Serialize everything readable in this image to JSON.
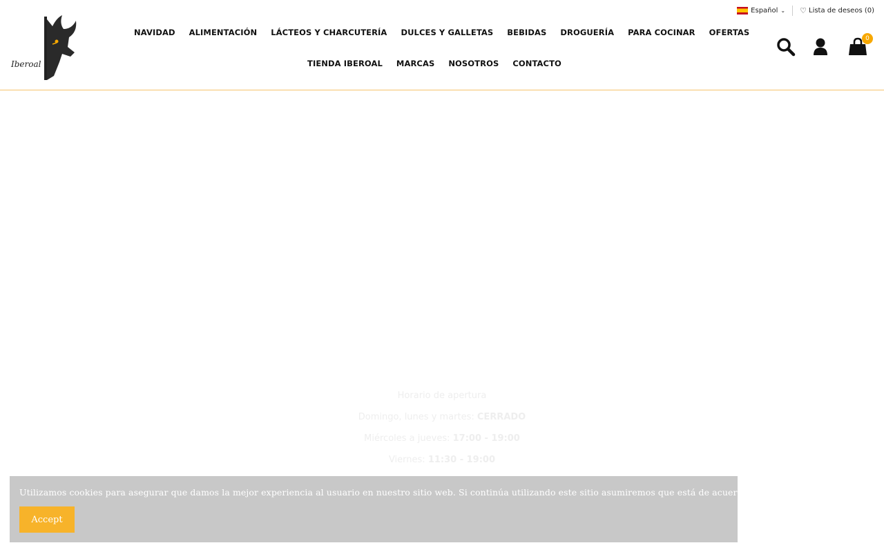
{
  "logo": {
    "text": "Iberoal"
  },
  "nav": {
    "row1": [
      "NAVIDAD",
      "ALIMENTACIÓN",
      "LÁCTEOS Y CHARCUTERÍA",
      "DULCES Y GALLETAS",
      "BEBIDAS",
      "DROGUERÍA",
      "PARA COCINAR",
      "OFERTAS"
    ],
    "row2": [
      "TIENDA IBEROAL",
      "MARCAS",
      "NOSOTROS",
      "CONTACTO"
    ]
  },
  "topbar": {
    "language": "Español",
    "wishlist": "Lista de deseos (0)"
  },
  "cart": {
    "count": "0"
  },
  "hours": {
    "title": "Horario de apertura",
    "line1_label": "Domingo, lunes y martes: ",
    "line1_value": "CERRADO",
    "line2_label": "Miércoles a jueves: ",
    "line2_value": "17:00 - 19:00",
    "line3_label": "Viernes: ",
    "line3_value": "11:30 - 19:00"
  },
  "cookie": {
    "message": "Utilizamos cookies para asegurar que damos la mejor experiencia al usuario en nuestro sitio web. Si continúa utilizando este sitio asumiremos que está de acuerdo.",
    "accept_label": "Accept"
  },
  "colors": {
    "accent": "#f7a800",
    "banner": "#c8c8c8",
    "button": "#f7b32a"
  }
}
